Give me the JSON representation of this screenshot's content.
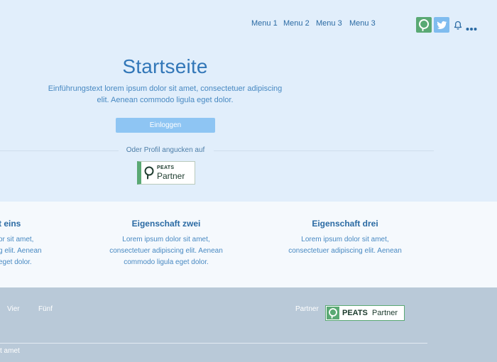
{
  "nav": {
    "menu": [
      "Menu 1",
      "Menu 2",
      "Menu 3",
      "Menu 3"
    ]
  },
  "hero": {
    "title": "Startseite",
    "intro_line1": "Einführungstext lorem ipsum dolor sit amet, consectetuer adipiscing",
    "intro_line2": "elit. Aenean commodo ligula eget dolor.",
    "login_label": "Einloggen",
    "profile_text": "Oder Profil angucken auf",
    "badge_small": "PEATS",
    "badge_big": "Partner"
  },
  "features": [
    {
      "title": "t eins",
      "lines": [
        "or sit amet,",
        "g elit. Aenean",
        "eget dolor."
      ]
    },
    {
      "title": "Eigenschaft zwei",
      "lines": [
        "Lorem ipsum dolor sit amet,",
        "consectetuer adipiscing elit. Aenean",
        "commodo ligula eget dolor."
      ]
    },
    {
      "title": "Eigenschaft drei",
      "lines": [
        "Lorem ipsum dolor sit amet,",
        "consectetuer adipiscing elit. Aenean"
      ]
    }
  ],
  "footer": {
    "links": [
      "Vier",
      "Fünf"
    ],
    "partner_label": "Partner",
    "badge_bold": "PEATS",
    "badge_text": "Partner",
    "copyright": "t amet"
  },
  "colors": {
    "brand_green": "#5aa974",
    "primary_blue": "#2a6aa3",
    "button_blue": "#8ec5f3",
    "twitter_blue": "#7fbcef"
  }
}
